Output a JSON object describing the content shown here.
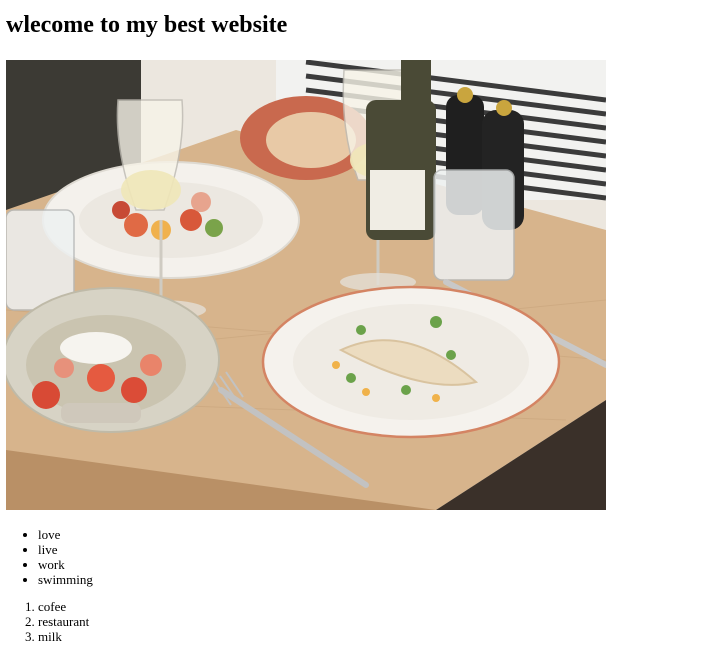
{
  "page": {
    "heading": "wlecome to my best website"
  },
  "photo": {
    "subject": "restaurant table with plated dishes and wine glasses"
  },
  "unordered_list": {
    "items": [
      "love",
      "live",
      "work",
      "swimming"
    ]
  },
  "ordered_list": {
    "items": [
      "cofee",
      "restaurant",
      "milk"
    ]
  }
}
